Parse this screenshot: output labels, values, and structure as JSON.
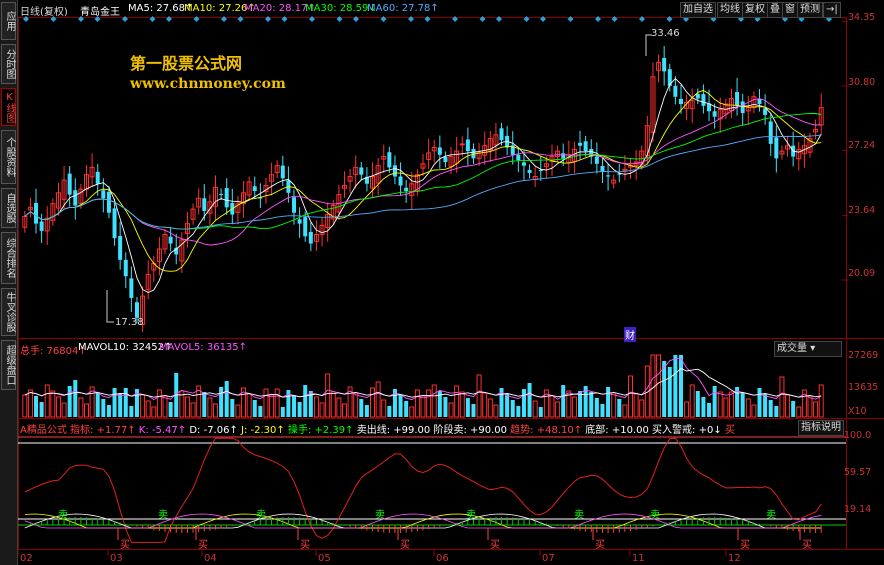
{
  "sidebar": {
    "tabs": [
      {
        "label": "应用",
        "active": false
      },
      {
        "label": "分时图",
        "active": false
      },
      {
        "label": "K线图",
        "active": true
      },
      {
        "label": "个股资料",
        "active": false
      },
      {
        "label": "自选股",
        "active": false
      },
      {
        "label": "综合排名",
        "active": false
      },
      {
        "label": "牛叉诊股",
        "active": false
      },
      {
        "label": "超级盘口",
        "active": false
      }
    ]
  },
  "header": {
    "period": "日线(复权)",
    "stock_name": "青岛金王",
    "ma": [
      {
        "label": "MA5: 27.68↑",
        "color": "#ffffff"
      },
      {
        "label": "MA10: 27.26↑",
        "color": "#ffff00"
      },
      {
        "label": "MA20: 28.17↑",
        "color": "#ff55ff"
      },
      {
        "label": "MA30: 28.59↓",
        "color": "#00ff00"
      },
      {
        "label": "MA60: 27.78↑",
        "color": "#55aaff"
      }
    ]
  },
  "toolbar": {
    "add_watch": "加自选",
    "ma_line": "均线",
    "restore_rights": "复权",
    "overlay": "叠",
    "window": "窗",
    "forecast": "预测",
    "collapse": "→|"
  },
  "watermark": {
    "line1": "第一股票公式网",
    "line2": "www.chnmoney.com"
  },
  "price_axis": {
    "ticks": [
      "34.35",
      "30.80",
      "27.24",
      "23.64",
      "20.09"
    ]
  },
  "annotations": {
    "high": "33.46",
    "low": "17.38",
    "report": "财"
  },
  "volume_panel": {
    "label_total": "总手: 76804↑",
    "label_mavol10": "MAVOL10: 32452↑",
    "label_mavol5": "MAVOL5: 36135↑",
    "dropdown": "成交量",
    "axis_ticks": [
      "27269",
      "13635"
    ],
    "unit": "X10"
  },
  "indicator_panel": {
    "title": "A精品公式 指标:",
    "values": [
      {
        "label": "+1.77↑",
        "color": "#ff4040"
      },
      {
        "label": "K: -5.47↑",
        "color": "#ff55ff"
      },
      {
        "label": "D: -7.06↑",
        "color": "#ffffff"
      },
      {
        "label": "J: -2.30↑",
        "color": "#ffff00"
      },
      {
        "label": "操手: +2.39↑",
        "color": "#00ff00"
      },
      {
        "label": "卖出线: +99.00",
        "color": "#ffffff"
      },
      {
        "label": "阶段卖: +90.00",
        "color": "#ffffff"
      },
      {
        "label": "趋势: +48.10↑",
        "color": "#ff4040"
      },
      {
        "label": "底部: +10.00",
        "color": "#ffffff"
      },
      {
        "label": "买入警戒: +0↓",
        "color": "#ffffff"
      },
      {
        "label": "买",
        "color": "#ff4040"
      }
    ],
    "help_button": "指标说明",
    "axis_ticks": [
      "100.0",
      "59.57",
      "19.14"
    ],
    "buy_mark": "买",
    "sell_mark": "卖"
  },
  "x_axis": {
    "months": [
      "02",
      "03",
      "04",
      "05",
      "06",
      "07",
      "11",
      "12"
    ]
  },
  "colors": {
    "up": "#ff3030",
    "down": "#40e0ff",
    "grid": "#8b0000",
    "axis_text": "#c33"
  },
  "chart_data": {
    "type": "candlestick",
    "price_range": [
      17.38,
      33.46
    ],
    "y_ticks": [
      34.35,
      30.8,
      27.24,
      23.64,
      20.09
    ],
    "close": [
      23.6,
      24.1,
      23.2,
      22.8,
      23.5,
      24.3,
      24.9,
      25.6,
      24.8,
      24.2,
      25.1,
      25.9,
      26.3,
      25.4,
      24.6,
      23.8,
      22.4,
      21.2,
      20.3,
      19.1,
      18.0,
      19.2,
      20.4,
      21.0,
      21.8,
      22.6,
      22.1,
      21.5,
      22.3,
      23.2,
      24.0,
      24.6,
      23.9,
      24.4,
      25.2,
      24.8,
      24.1,
      23.7,
      24.3,
      24.9,
      25.5,
      25.0,
      24.6,
      25.3,
      25.9,
      26.4,
      25.7,
      24.9,
      23.8,
      23.2,
      22.5,
      22.1,
      22.6,
      23.1,
      23.7,
      24.2,
      24.8,
      25.3,
      25.8,
      26.3,
      25.9,
      25.4,
      25.8,
      26.4,
      26.9,
      26.3,
      25.8,
      25.3,
      25.0,
      25.4,
      25.9,
      26.5,
      27.1,
      27.4,
      27.0,
      26.6,
      26.9,
      27.2,
      27.6,
      27.2,
      26.8,
      27.1,
      27.5,
      27.9,
      28.1,
      27.8,
      27.4,
      27.0,
      26.7,
      26.4,
      26.0,
      25.8,
      26.1,
      26.5,
      26.9,
      27.2,
      26.8,
      27.0,
      27.3,
      27.5,
      27.2,
      26.9,
      26.5,
      26.1,
      25.8,
      25.6,
      25.9,
      26.2,
      26.4,
      26.6,
      27.2,
      28.6,
      31.3,
      32.1,
      31.6,
      30.8,
      30.2,
      29.8,
      29.9,
      30.0,
      30.1,
      29.7,
      29.4,
      29.1,
      29.5,
      29.8,
      30.1,
      29.7,
      29.3,
      29.6,
      30.2,
      29.8,
      29.2,
      27.6,
      26.8,
      27.2,
      27.5,
      26.9,
      27.3,
      27.5,
      27.9,
      28.4,
      29.6
    ],
    "volume_axis": [
      27269,
      13635
    ],
    "indicator_axis": [
      100.0,
      59.57,
      19.14
    ],
    "months": [
      "02",
      "03",
      "04",
      "05",
      "06",
      "07",
      "11",
      "12"
    ]
  }
}
